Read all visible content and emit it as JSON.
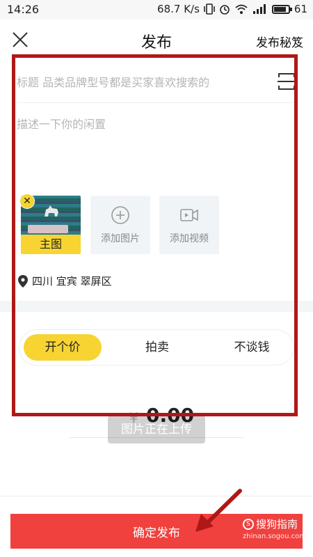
{
  "status_bar": {
    "time": "14:26",
    "speed": "68.7 K/s",
    "battery": "61"
  },
  "header": {
    "title": "发布",
    "tips_label": "发布秘笈"
  },
  "form": {
    "title_placeholder": "标题 品类品牌型号都是买家喜欢搜索的",
    "desc_placeholder": "描述一下你的闲置"
  },
  "media": {
    "main_image_label": "主图",
    "add_image_label": "添加图片",
    "add_video_label": "添加视频"
  },
  "location": {
    "text": "四川 宜宾 翠屏区"
  },
  "price_mode": {
    "options": [
      "开个价",
      "拍卖",
      "不谈钱"
    ],
    "selected": "开个价"
  },
  "price": {
    "currency": "¥",
    "value": "0.00"
  },
  "toast": {
    "text": "图片正在上传"
  },
  "submit": {
    "label": "确定发布"
  },
  "watermark": {
    "brand": "搜狗指南",
    "url": "zhinan.sogou.com"
  },
  "colors": {
    "accent_yellow": "#f7d431",
    "submit_red": "#f0413f",
    "annotation_red": "#b01717"
  }
}
